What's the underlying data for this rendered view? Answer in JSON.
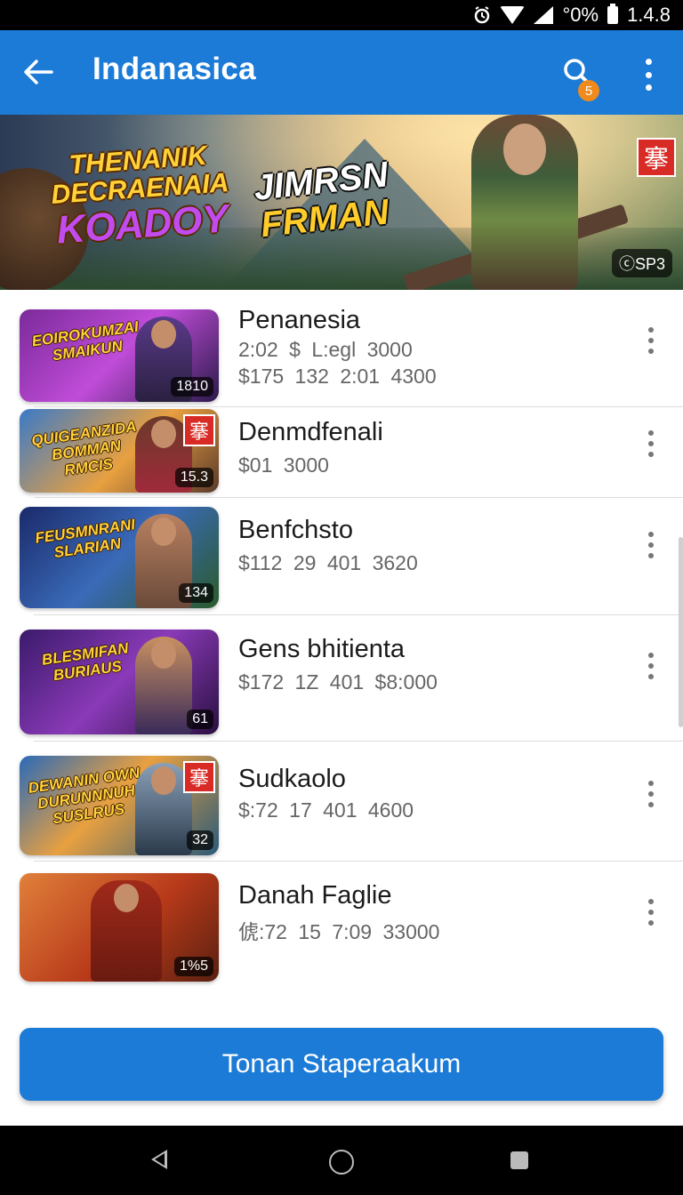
{
  "status_bar": {
    "battery_text": "°0%",
    "time": "1.4.8",
    "icons": [
      "alarm-icon",
      "wifi-icon",
      "signal-icon",
      "battery-icon"
    ]
  },
  "app_bar": {
    "title": "Indanasica",
    "search_badge": "5",
    "icons": [
      "back-arrow-icon",
      "search-icon",
      "more-vert-icon"
    ]
  },
  "banner": {
    "headline_1": "THENANIK DECRAENAIA",
    "headline_1_big": "KOADOY",
    "headline_2": "JIMRSN",
    "headline_2_b": "FRMAN",
    "tag": "搴",
    "chip": "ⓒSP3"
  },
  "games": [
    {
      "name": "Penanesia",
      "meta": [
        "2:02  $ L:egl  3000",
        "$175  132  2:01  4300"
      ],
      "thumb_title": "EOIROKUMZAI SMAIKUN",
      "thumb_count": "1810",
      "has_tag": false
    },
    {
      "name": "Denmdfenali",
      "meta": [
        "$01  3000"
      ],
      "thumb_title": "QUIGEANZIDA BOMMAN RMCIS",
      "thumb_count": "15.3",
      "has_tag": true
    },
    {
      "name": "Benfchsto",
      "meta": [
        "$112   29  401  3620"
      ],
      "thumb_title": "FEUSMNRANI SLARIAN",
      "thumb_count": "134",
      "has_tag": false
    },
    {
      "name": "Gens bhitienta",
      "meta": [
        "$172   1Z  401  $8:000"
      ],
      "thumb_title": "BLESMIFAN BURIAUS",
      "thumb_count": "61",
      "has_tag": false
    },
    {
      "name": "Sudkaolo",
      "meta": [
        "$:72   17  401  4600"
      ],
      "thumb_title": "DEWANIN OWN DURUNNNUH SUSLRUS",
      "thumb_count": "32",
      "has_tag": true
    },
    {
      "name": "Danah Faglie",
      "meta": [
        "俿:72   15  7:09  33000"
      ],
      "thumb_title": "",
      "thumb_count": "1%5",
      "has_tag": false
    }
  ],
  "thumb_tag": "搴",
  "cta": {
    "label": "Tonan Staperaakum"
  },
  "colors": {
    "primary": "#1b7bd6",
    "badge": "#f08a1c",
    "tag_red": "#d92b25"
  }
}
